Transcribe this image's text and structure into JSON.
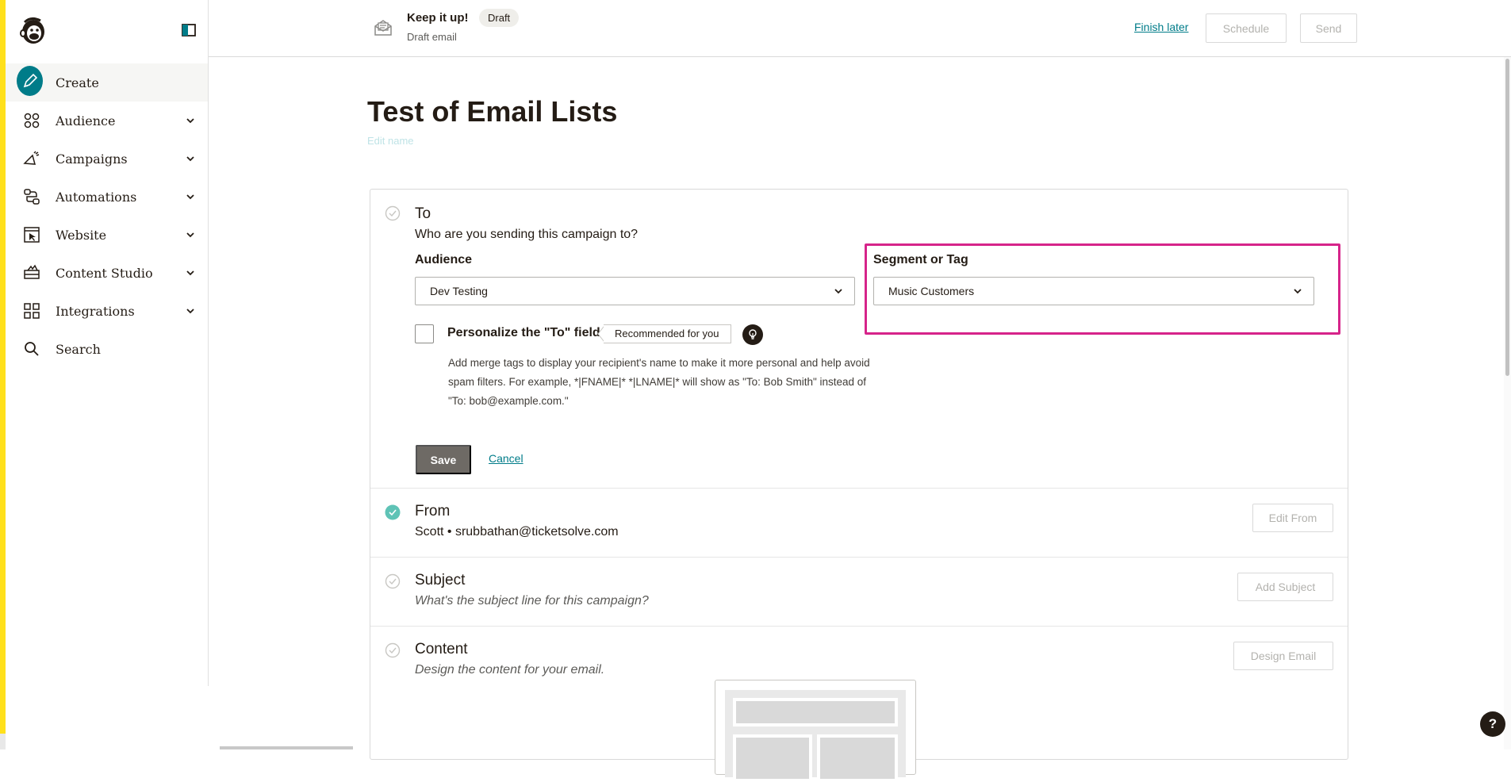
{
  "sidebar": {
    "items": [
      {
        "label": "Create",
        "icon": "create-pencil-icon",
        "active": true,
        "has_chevron": false
      },
      {
        "label": "Audience",
        "icon": "audience-icon",
        "has_chevron": true
      },
      {
        "label": "Campaigns",
        "icon": "megaphone-icon",
        "has_chevron": true
      },
      {
        "label": "Automations",
        "icon": "automations-icon",
        "has_chevron": true
      },
      {
        "label": "Website",
        "icon": "website-cursor-icon",
        "has_chevron": true
      },
      {
        "label": "Content Studio",
        "icon": "content-studio-icon",
        "has_chevron": true
      },
      {
        "label": "Integrations",
        "icon": "integrations-grid-icon",
        "has_chevron": true
      },
      {
        "label": "Search",
        "icon": "search-icon",
        "has_chevron": false
      }
    ]
  },
  "header": {
    "title": "Keep it up!",
    "badge": "Draft",
    "subtitle": "Draft email",
    "finish_later": "Finish later",
    "schedule": "Schedule",
    "send": "Send"
  },
  "main": {
    "title": "Test of Email Lists",
    "edit_name": "Edit name",
    "to": {
      "title": "To",
      "subtitle": "Who are you sending this campaign to?",
      "audience_label": "Audience",
      "audience_value": "Dev Testing",
      "segment_label": "Segment or Tag",
      "segment_value": "Music Customers",
      "personalize_label": "Personalize the \"To\" field",
      "recommended": "Recommended for you",
      "help_text": "Add merge tags to display your recipient's name to make it more personal and help avoid spam filters. For example, *|FNAME|* *|LNAME|* will show as \"To: Bob Smith\" instead of \"To: bob@example.com.\"",
      "save": "Save",
      "cancel": "Cancel"
    },
    "from": {
      "title": "From",
      "value": "Scott • srubbathan@ticketsolve.com",
      "button": "Edit From"
    },
    "subject": {
      "title": "Subject",
      "placeholder": "What's the subject line for this campaign?",
      "button": "Add Subject"
    },
    "content": {
      "title": "Content",
      "subtitle": "Design the content for your email.",
      "button": "Design Email"
    }
  },
  "help_fab": "?",
  "colors": {
    "accent": "#007c89",
    "highlight": "#d6248a",
    "brand_yellow": "#ffe01b",
    "check_done": "#5fc3b6"
  }
}
